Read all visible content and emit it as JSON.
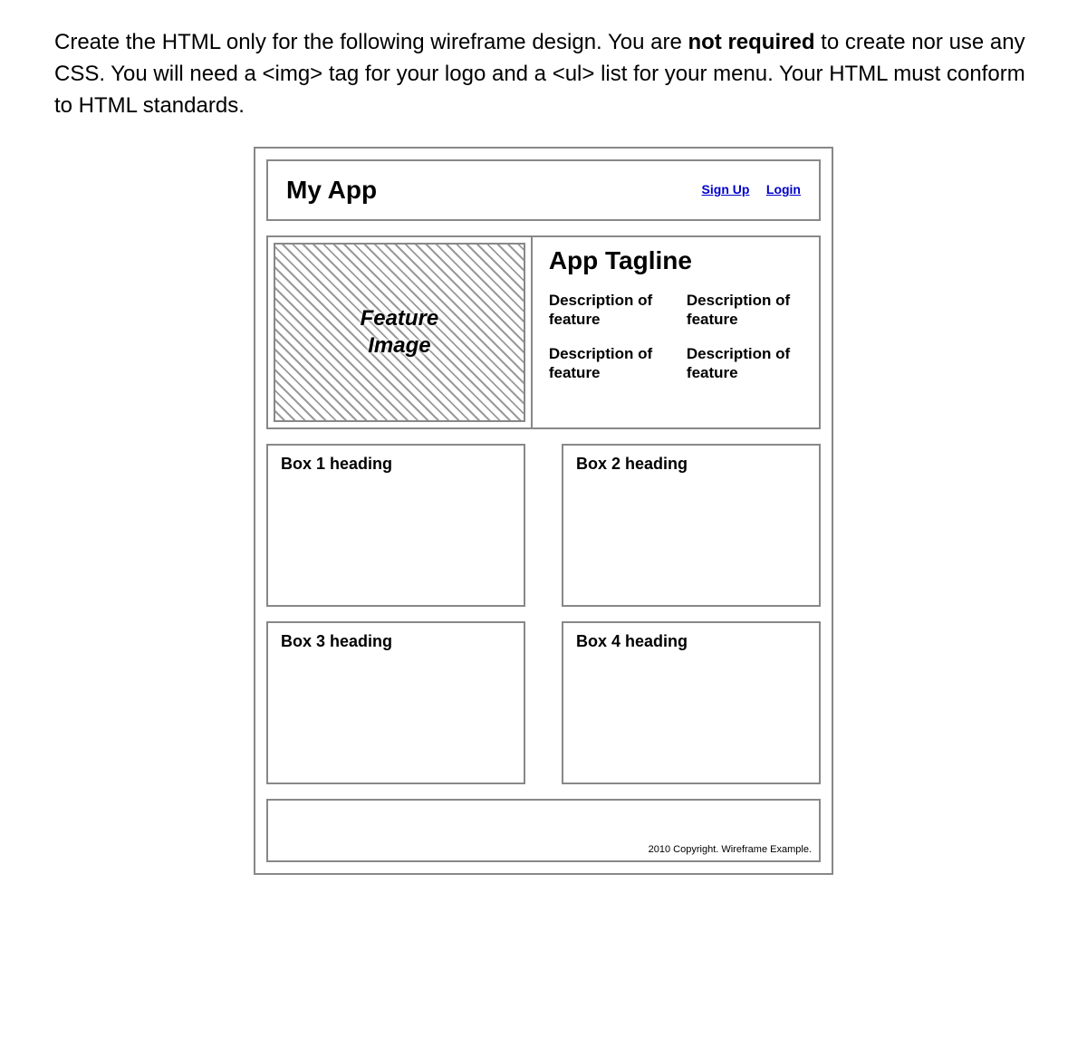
{
  "instructions": {
    "part1": "Create the HTML only for the following wireframe design.  You are ",
    "bold1": "not required",
    "part2": " to create nor use any CSS. You will need a <img> tag for your logo and a <ul> list for your menu. Your HTML must conform to HTML standards."
  },
  "wireframe": {
    "header": {
      "logo_text": "My App",
      "signup_label": "Sign Up",
      "login_label": "Login"
    },
    "feature": {
      "image_label_line1": "Feature",
      "image_label_line2": "Image",
      "tagline": "App Tagline",
      "descriptions": [
        "Description of feature",
        "Description of feature",
        "Description of feature",
        "Description of feature"
      ]
    },
    "boxes": [
      {
        "heading": "Box 1 heading"
      },
      {
        "heading": "Box 2 heading"
      },
      {
        "heading": "Box 3 heading"
      },
      {
        "heading": "Box 4 heading"
      }
    ],
    "footer": {
      "copyright": "2010 Copyright. Wireframe Example."
    }
  }
}
